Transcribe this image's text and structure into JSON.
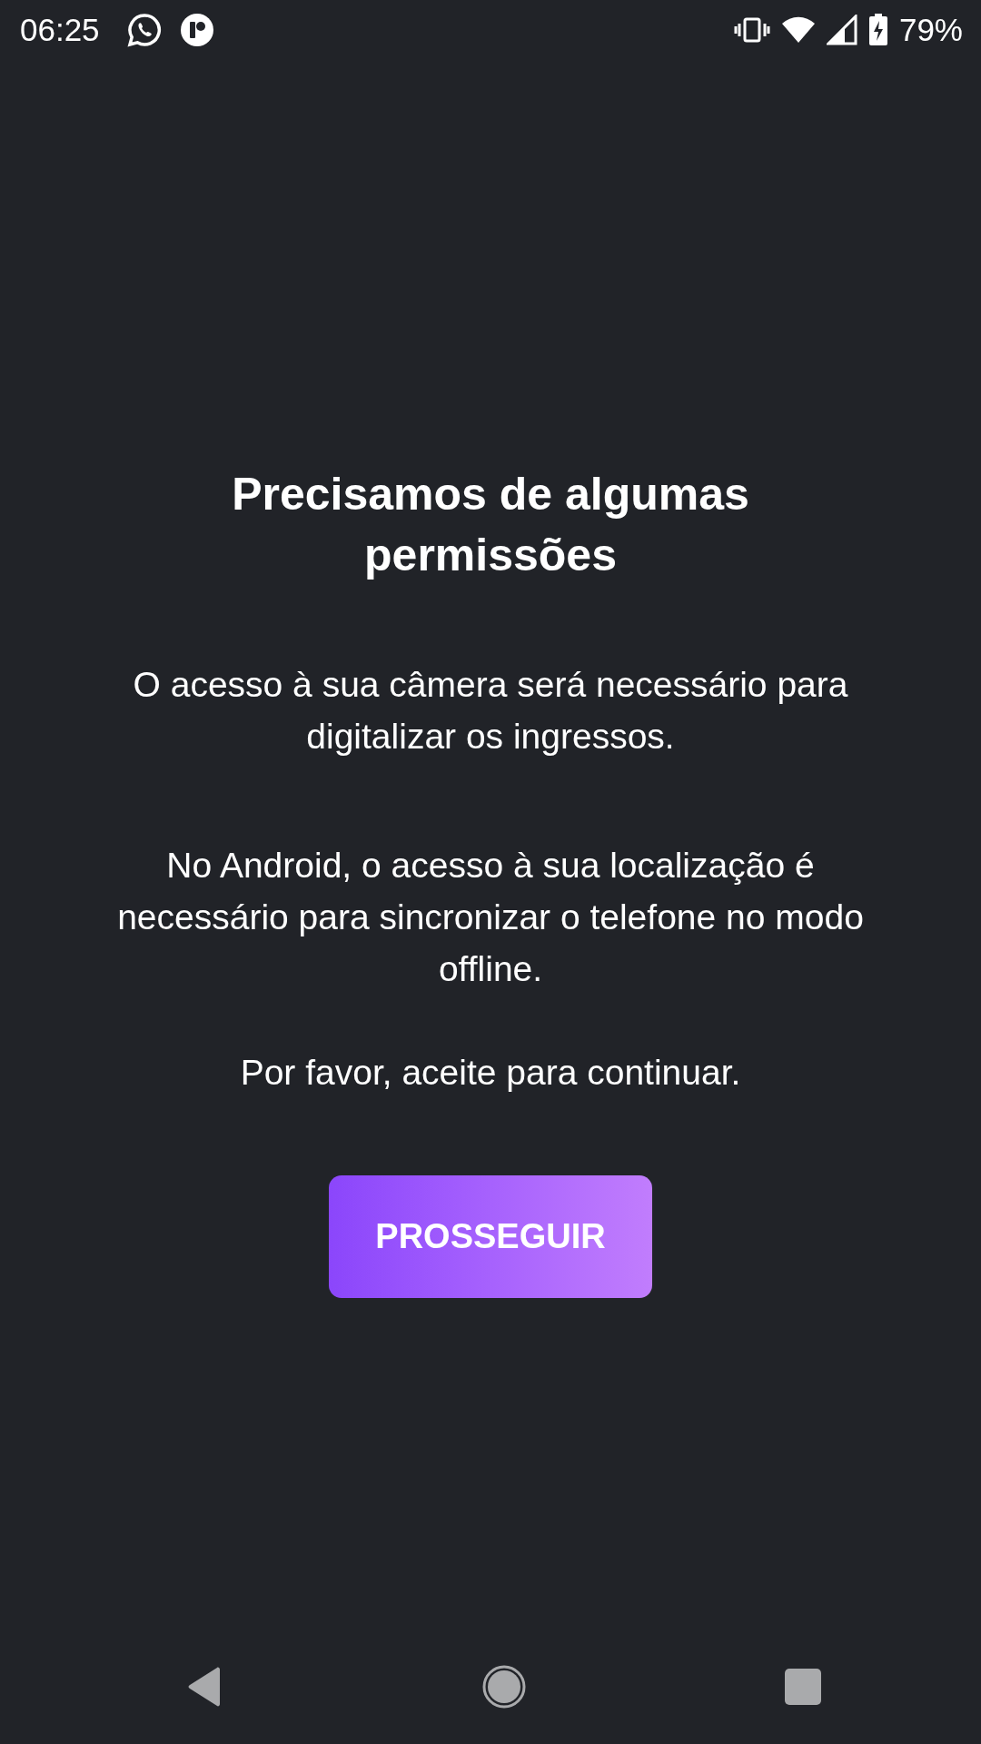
{
  "status_bar": {
    "time": "06:25",
    "battery": "79%"
  },
  "title": "Precisamos de algumas permissões",
  "paragraphs": [
    "O acesso à sua câmera será necessário para digitalizar os ingressos.",
    "No Android, o acesso à sua localização é necessário para sincronizar o telefone no modo offline.",
    "Por favor, aceite para continuar."
  ],
  "button": "PROSSEGUIR"
}
